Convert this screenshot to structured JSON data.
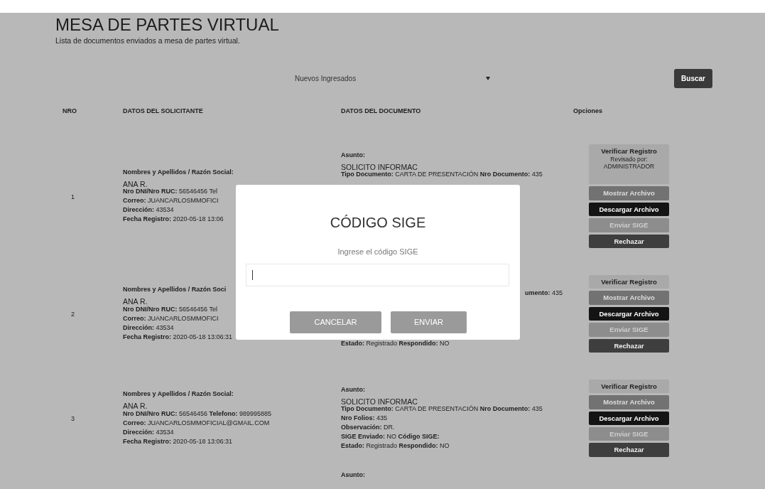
{
  "header": {
    "title": "MESA DE PARTES VIRTUAL",
    "subtitle": "Lista de documentos enviados a mesa de partes virtual."
  },
  "filter": {
    "value": "Nuevos Ingresados",
    "button": "Buscar"
  },
  "table": {
    "columns": [
      "NRO",
      "DATOS DEL SOLICITANTE",
      "DATOS DEL DOCUMENTO",
      "Opciones"
    ],
    "rows": [
      {
        "nro": "1",
        "applicant": [
          {
            "kind": "label",
            "text": "Nombres y Apellidos / Razón Social:"
          },
          {
            "kind": "name",
            "text": "ANA R."
          },
          {
            "kind": "field",
            "text": "**Nro DNI/Nro RUC:** 56546456 Tel"
          },
          {
            "kind": "field",
            "text": "**Correo:** JUANCARLOSMMOFICI"
          },
          {
            "kind": "field",
            "text": "**Dirección:** 43534"
          },
          {
            "kind": "field",
            "text": "**Fecha Registro:** 2020-05-18 13:06"
          }
        ],
        "document": [
          {
            "kind": "label",
            "text": "Asunto:"
          },
          {
            "kind": "name",
            "text": "SOLICITO INFORMAC"
          },
          {
            "kind": "cut",
            "text": "**Tipo Documento:** CARTA DE PRESENTACIÓN **Nro Documento:** 435"
          }
        ],
        "options": [
          {
            "kind": "verify",
            "label": "Verificar Registro",
            "note": "Revisado por: ADMINISTRADOR"
          },
          {
            "kind": "show",
            "label": "Mostrar Archivo"
          },
          {
            "kind": "download",
            "label": "Descargar Archivo"
          },
          {
            "kind": "send",
            "label": "Enviar SIGE"
          },
          {
            "kind": "reject",
            "label": "Rechazar"
          }
        ]
      },
      {
        "nro": "2",
        "applicant": [
          {
            "kind": "label",
            "text": "Nombres y Apellidos / Razón Soci"
          },
          {
            "kind": "name",
            "text": "ANA R."
          },
          {
            "kind": "field",
            "text": "**Nro DNI/Nro RUC:** 56546456 Tel"
          },
          {
            "kind": "field",
            "text": "**Correo:** JUANCARLOSMMOFICI"
          },
          {
            "kind": "field",
            "text": "**Dirección:** 43534"
          },
          {
            "kind": "field",
            "text": "**Fecha Registro:** 2020-05-18 13:06:31"
          }
        ],
        "document": [
          {
            "kind": "fragment",
            "text": "**umento:** 435"
          },
          {
            "kind": "field",
            "text": "**Estado:** Registrado **Respondido:** NO"
          }
        ],
        "options": [
          {
            "kind": "verify",
            "label": "Verificar Registro"
          },
          {
            "kind": "show",
            "label": "Mostrar Archivo"
          },
          {
            "kind": "download",
            "label": "Descargar Archivo"
          },
          {
            "kind": "send",
            "label": "Enviar SIGE"
          },
          {
            "kind": "reject",
            "label": "Rechazar"
          }
        ]
      },
      {
        "nro": "3",
        "applicant": [
          {
            "kind": "label",
            "text": "Nombres y Apellidos / Razón Social:"
          },
          {
            "kind": "name",
            "text": "ANA R."
          },
          {
            "kind": "field",
            "text": "**Nro DNI/Nro RUC:** 56546456 **Telefono:** 989995885"
          },
          {
            "kind": "field",
            "text": "**Correo:** JUANCARLOSMMOFICIAL@GMAIL.COM"
          },
          {
            "kind": "field",
            "text": "**Dirección:** 43534"
          },
          {
            "kind": "field",
            "text": "**Fecha Registro:** 2020-05-18 13:06:31"
          }
        ],
        "document": [
          {
            "kind": "label",
            "text": "Asunto:"
          },
          {
            "kind": "name",
            "text": "SOLICITO INFORMAC"
          },
          {
            "kind": "field",
            "text": "**Tipo Documento:** CARTA DE PRESENTACIÓN **Nro Documento:** 435"
          },
          {
            "kind": "field",
            "text": "**Nro Folios:** 435"
          },
          {
            "kind": "field",
            "text": "**Observación:** DR."
          },
          {
            "kind": "field",
            "text": "**SIGE Enviado:** NO **Código SIGE:**"
          },
          {
            "kind": "field",
            "text": "**Estado:** Registrado **Respondido:** NO"
          }
        ],
        "options": [
          {
            "kind": "verify",
            "label": "Verificar Registro"
          },
          {
            "kind": "show",
            "label": "Mostrar Archivo"
          },
          {
            "kind": "download",
            "label": "Descargar Archivo"
          },
          {
            "kind": "send",
            "label": "Enviar SIGE"
          },
          {
            "kind": "reject",
            "label": "Rechazar"
          }
        ]
      }
    ],
    "next_row": {
      "document": [
        {
          "kind": "label",
          "text": "Asunto:"
        }
      ]
    }
  },
  "modal": {
    "title": "CÓDIGO SIGE",
    "label": "Ingrese el código SIGE",
    "buttons": [
      "CANCELAR",
      "ENVIAR"
    ]
  }
}
